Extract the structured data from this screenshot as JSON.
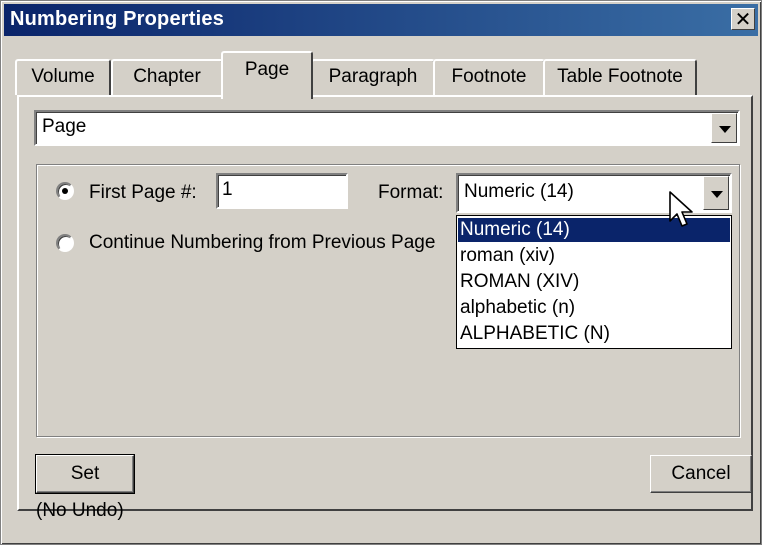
{
  "window": {
    "title": "Numbering Properties",
    "close_glyph": "✕"
  },
  "tabs": [
    {
      "label": "Volume",
      "active": false
    },
    {
      "label": "Chapter",
      "active": false
    },
    {
      "label": "Page",
      "active": true
    },
    {
      "label": "Paragraph",
      "active": false
    },
    {
      "label": "Footnote",
      "active": false
    },
    {
      "label": "Table Footnote",
      "active": false
    }
  ],
  "scope_select": {
    "value": "Page"
  },
  "first_page": {
    "label": "First Page #:",
    "value": "1",
    "selected": true
  },
  "continue_numbering": {
    "label": "Continue Numbering from Previous Page",
    "selected": false
  },
  "format": {
    "label": "Format:",
    "value": "Numeric  (14)",
    "options": [
      "Numeric  (14)",
      "roman  (xiv)",
      "ROMAN  (XIV)",
      "alphabetic  (n)",
      "ALPHABETIC  (N)"
    ],
    "highlighted_index": 0
  },
  "buttons": {
    "set": "Set",
    "cancel": "Cancel"
  },
  "undo_note": "(No Undo)",
  "colors": {
    "face": "#d4d0c8",
    "title_bar": "#0a246a",
    "selection": "#0a246a"
  },
  "icons": {
    "close": "close-icon",
    "dropdown": "chevron-down-icon",
    "cursor": "mouse-pointer-icon"
  }
}
